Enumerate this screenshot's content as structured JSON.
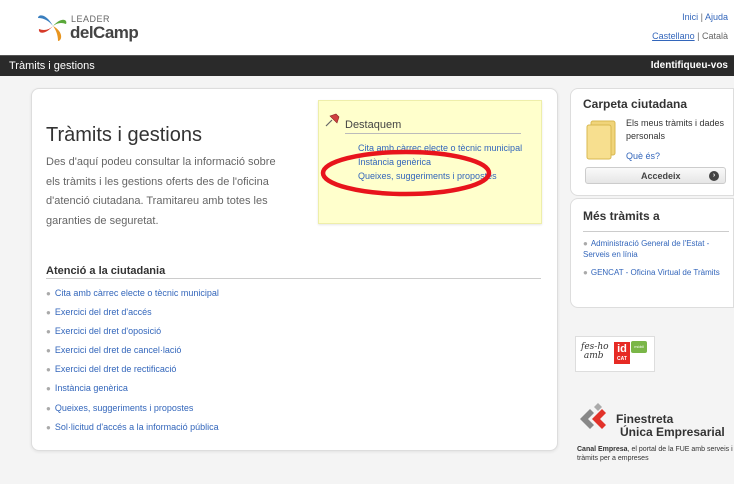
{
  "header": {
    "logo": {
      "leader": "LEADER",
      "name": "delCamp"
    },
    "top_links": {
      "inici": "Inici",
      "ajuda": "Ajuda",
      "sep": "|"
    },
    "lang_links": {
      "castellano": "Castellano",
      "catala": "Català",
      "sep": "|"
    }
  },
  "navbar": {
    "title": "Tràmits i gestions",
    "login": "Identifiqueu-vos"
  },
  "main": {
    "title": "Tràmits i gestions",
    "intro": "Des d'aquí podeu consultar la informació sobre els tràmits i les gestions oferts des de l'oficina d'atenció ciutadana. Tramitareu amb totes les garanties de seguretat."
  },
  "destaquem": {
    "title": "Destaquem",
    "links": [
      "Cita amb càrrec electe o tècnic municipal",
      "Instància genèrica",
      "Queixes, suggeriments i propostes"
    ]
  },
  "atencio": {
    "title": "Atenció a la ciutadania",
    "items": [
      "Cita amb càrrec electe o tècnic municipal",
      "Exercici del dret d'accés",
      "Exercici del dret d'oposició",
      "Exercici del dret de cancel·lació",
      "Exercici del dret de rectificació",
      "Instància genèrica",
      "Queixes, suggeriments i propostes",
      "Sol·licitud d'accés a la informació pública"
    ]
  },
  "carpeta": {
    "title": "Carpeta ciutadana",
    "desc": "Els meus tràmits i dades personals",
    "what": "Què és?",
    "button": "Accedeix"
  },
  "mes_tramits": {
    "title": "Més tràmits a",
    "items": [
      "Administració General de l'Estat - Serveis en línia",
      "GENCAT - Oficina Virtual de Tràmits"
    ]
  },
  "fesho": {
    "text1": "fes-ho",
    "text2": "amb",
    "id": "id",
    "cat": "CAT",
    "mobile": "mòbil"
  },
  "fue": {
    "line1": "Finestreta",
    "line2": "Única Empresarial",
    "bold": "Canal Empresa",
    "rest": ", el portal de la FUE amb serveis i tràmits per a empreses"
  },
  "colors": {
    "navbar": "#2a2a2a",
    "link": "#3366bb",
    "highlight": "#ffffcc",
    "annotation": "#e8141c"
  }
}
